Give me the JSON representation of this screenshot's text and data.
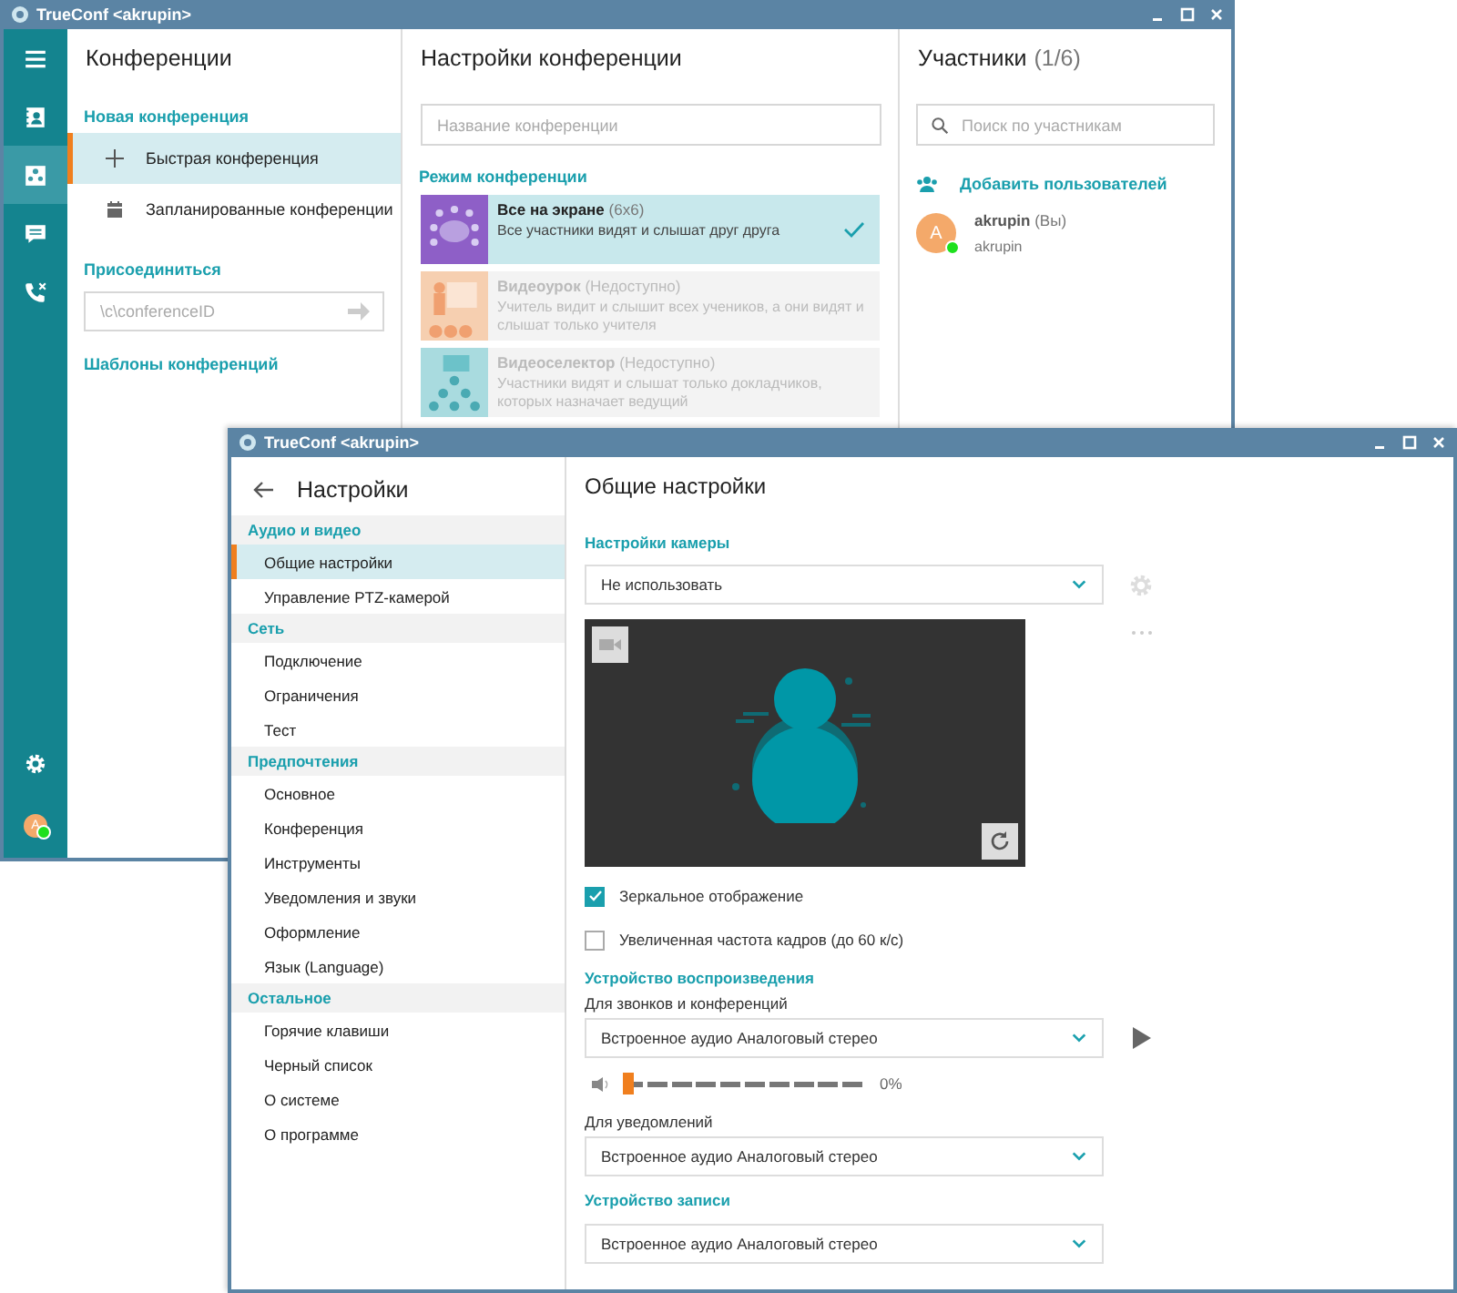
{
  "conference_window": {
    "title": "TrueConf <akrupin>",
    "rail": {
      "items": [
        {
          "kind": "menu",
          "selected": false
        },
        {
          "kind": "contacts",
          "selected": false
        },
        {
          "kind": "conferences",
          "selected": true
        },
        {
          "kind": "chat",
          "selected": false
        },
        {
          "kind": "calls",
          "selected": false
        }
      ],
      "bottom": [
        {
          "kind": "settings",
          "selected": false
        }
      ],
      "avatar": {
        "initial": "A",
        "online": true
      }
    },
    "conferences": {
      "title": "Конференции",
      "new_section": "Новая конференция",
      "items": [
        {
          "kind": "plus",
          "label": "Быстрая конференция",
          "selected": true
        },
        {
          "kind": "calendar",
          "label": "Запланированные конференции",
          "selected": false
        }
      ],
      "join_section": "Присоединиться",
      "join_field": {
        "placeholder": "\\c\\conferenceID"
      },
      "templates_link": "Шаблоны конференций"
    },
    "conference_settings": {
      "title": "Настройки конференции",
      "name_field": {
        "placeholder": "Название конференции"
      },
      "mode_section": "Режим конференции",
      "modes": [
        {
          "kind": "grid",
          "name": "Все на экране",
          "note": "(6x6)",
          "description": "Все участники видят и слышат друг друга",
          "selected": true,
          "disabled": false,
          "color": "#8e5fc7"
        },
        {
          "kind": "lesson",
          "name": "Видеоурок",
          "note": "(Недоступно)",
          "description": "Учитель видит и слышит всех учеников, а они видят и слышат только учителя",
          "selected": false,
          "disabled": true,
          "color": "#f6cfb0"
        },
        {
          "kind": "selector",
          "name": "Видеоселектор",
          "note": "(Недоступно)",
          "description": "Участники видят и слышат только докладчиков, которых назначает ведущий",
          "selected": false,
          "disabled": true,
          "color": "#a9dbdf"
        }
      ]
    },
    "participants": {
      "title": "Участники",
      "count": "(1/6)",
      "search": {
        "placeholder": "Поиск по участникам"
      },
      "add_button": "Добавить пользователей",
      "list": [
        {
          "initial": "A",
          "name": "akrupin",
          "note": "(Вы)",
          "login": "akrupin",
          "online": true
        }
      ]
    }
  },
  "settings_window": {
    "title": "TrueConf <akrupin>",
    "nav": {
      "title": "Настройки",
      "groups": [
        {
          "label": "Аудио и видео",
          "items": [
            {
              "label": "Общие настройки",
              "selected": true
            },
            {
              "label": "Управление PTZ-камерой",
              "selected": false
            }
          ]
        },
        {
          "label": "Сеть",
          "items": [
            {
              "label": "Подключение",
              "selected": false
            },
            {
              "label": "Ограничения",
              "selected": false
            },
            {
              "label": "Тест",
              "selected": false
            }
          ]
        },
        {
          "label": "Предпочтения",
          "items": [
            {
              "label": "Основное",
              "selected": false
            },
            {
              "label": "Конференция",
              "selected": false
            },
            {
              "label": "Инструменты",
              "selected": false
            },
            {
              "label": "Уведомления и звуки",
              "selected": false
            },
            {
              "label": "Оформление",
              "selected": false
            },
            {
              "label": "Язык (Language)",
              "selected": false
            }
          ]
        },
        {
          "label": "Остальное",
          "items": [
            {
              "label": "Горячие клавиши",
              "selected": false
            },
            {
              "label": "Черный список",
              "selected": false
            },
            {
              "label": "О системе",
              "selected": false
            },
            {
              "label": "О программе",
              "selected": false
            }
          ]
        }
      ]
    },
    "content": {
      "title": "Общие настройки",
      "camera_section": "Настройки камеры",
      "camera_select": {
        "value": "Не использовать"
      },
      "checkboxes": [
        {
          "label": "Зеркальное отображение",
          "checked": true
        },
        {
          "label": "Увеличенная частота кадров (до 60 к/с)",
          "checked": false
        }
      ],
      "playback_section": "Устройство воспроизведения",
      "calls_label": "Для звонков и конференций",
      "calls_select": {
        "value": "Встроенное аудио Аналоговый стерео"
      },
      "volume": {
        "level": 0,
        "reading": "0%"
      },
      "notifications_label": "Для уведомлений",
      "notifications_select": {
        "value": "Встроенное аудио Аналоговый стерео"
      },
      "record_section": "Устройство записи",
      "record_select": {
        "value": "Встроенное аудио Аналоговый стерео"
      }
    }
  }
}
